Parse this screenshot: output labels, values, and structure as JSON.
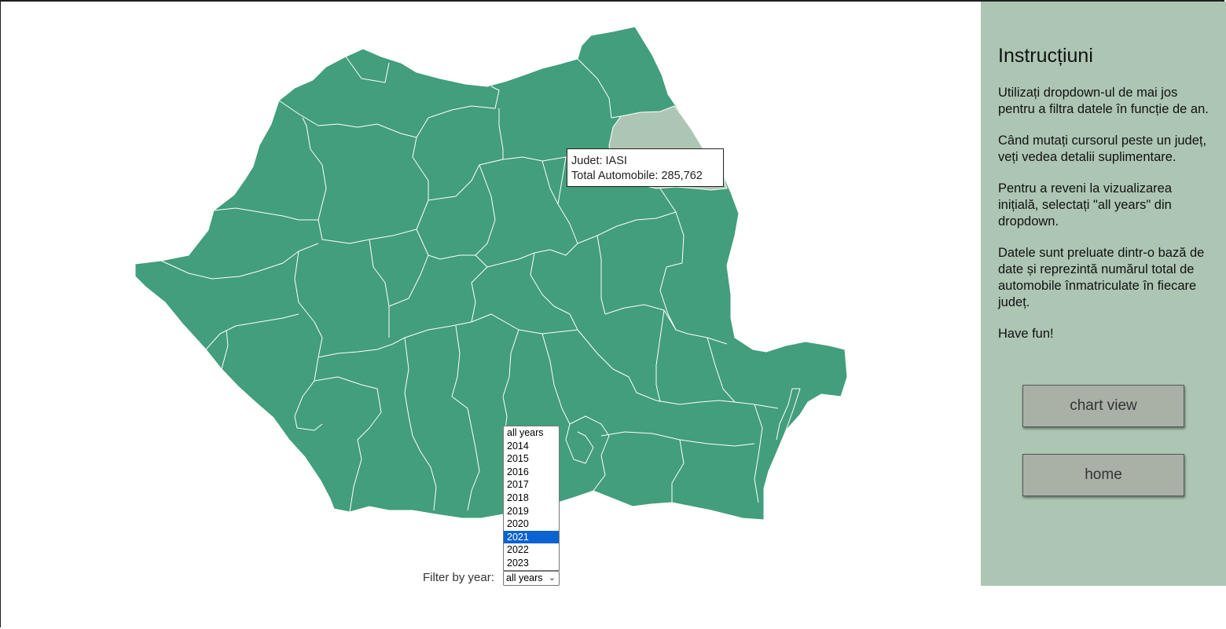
{
  "map": {
    "fill_color": "#429e7c",
    "highlight_color": "#adc6b3",
    "border_color": "#ffffff"
  },
  "tooltip": {
    "county_line": "Judet: IASI",
    "total_line": "Total Automobile: 285,762"
  },
  "filter": {
    "label": "Filter by year:",
    "selected": "all years",
    "options": [
      "all years",
      "2014",
      "2015",
      "2016",
      "2017",
      "2018",
      "2019",
      "2020",
      "2021",
      "2022",
      "2023"
    ],
    "highlighted": "2021"
  },
  "sidebar": {
    "background": "#adc6b3",
    "title": "Instrucțiuni",
    "paragraphs": [
      "Utilizați dropdown-ul de mai jos pentru a filtra datele în funcție de an.",
      "Când mutați cursorul peste un județ, veți vedea detalii suplimentare.",
      "Pentru a reveni la vizualizarea inițială, selectați \"all years\" din dropdown.",
      "Datele sunt preluate dintr-o bază de date și reprezintă numărul total de automobile înmatriculate în fiecare județ.",
      "Have fun!"
    ],
    "buttons": {
      "chart": "chart view",
      "home": "home"
    }
  }
}
